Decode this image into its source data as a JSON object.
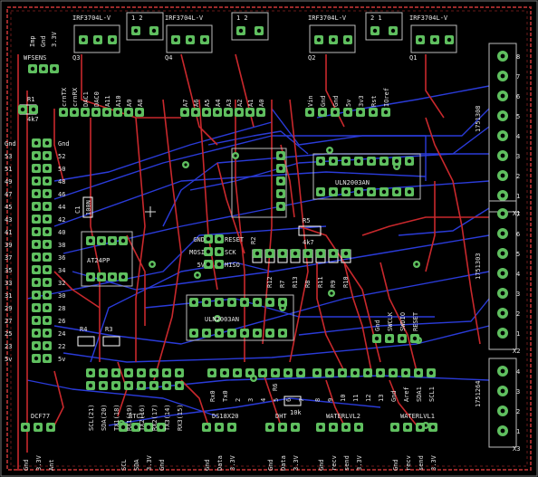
{
  "board": {
    "colors": {
      "background": "#000000",
      "top_copper": "#c8282c",
      "bottom_copper": "#2a3bd8",
      "pad": "#5fbf5f",
      "silk": "#e6e6e6",
      "frame": "#9a2a2a"
    },
    "mosfets": [
      {
        "part": "IRF3704L-V",
        "ref": "Q3",
        "pins": "G D S"
      },
      {
        "part": "IRF3704L-V",
        "ref": "Q4",
        "pins": "G D S"
      },
      {
        "part": "IRF3704L-V",
        "ref": "Q2",
        "pins": "G D S"
      },
      {
        "part": "IRF3704L-V",
        "ref": "Q1",
        "pins": "G D S"
      }
    ],
    "jumpers": [
      "1 2",
      "1 2",
      "2 1",
      "2 1"
    ],
    "sensor_header": {
      "name": "WFSENS",
      "pins": [
        "Imp",
        "Gnd",
        "3.3V"
      ]
    },
    "resistors": [
      "R1",
      "4k7",
      "R2",
      "R5",
      "4k7",
      "R3",
      "R4",
      "R6",
      "10k",
      "R7",
      "R8",
      "R9",
      "R10",
      "R11",
      "R12",
      "R13"
    ],
    "capacitors": [
      "C1",
      "100N"
    ],
    "ics": [
      "AT24PP",
      "ULN2003AN",
      "ULN2003AN"
    ],
    "icsp": [
      "GND",
      "MOSI",
      "5V",
      "RESET",
      "SCK",
      "MISO"
    ],
    "arduino_top_left": [
      "crnTX",
      "crnRX",
      "DAC1",
      "DAC0",
      "A11",
      "A10",
      "A9",
      "A8"
    ],
    "arduino_top_mid": [
      "A7",
      "A6",
      "A5",
      "A4",
      "A3",
      "A2",
      "A1",
      "A0"
    ],
    "arduino_top_right": [
      "Vin",
      "Gnd",
      "Gnd",
      "5v",
      "3v3",
      "Rst",
      "IOref"
    ],
    "left_pins": [
      "Gnd",
      "53",
      "51",
      "49",
      "47",
      "45",
      "43",
      "41",
      "39",
      "37",
      "35",
      "33",
      "31",
      "29",
      "27",
      "25",
      "23",
      "5v"
    ],
    "right_pins": [
      "Gnd",
      "52",
      "50",
      "48",
      "46",
      "44",
      "42",
      "40",
      "38",
      "36",
      "34",
      "32",
      "30",
      "28",
      "26",
      "24",
      "22",
      "5v"
    ],
    "bottom_left": [
      "SCL(21)",
      "SDA(20)",
      "TX1(18)",
      "RX1(19)",
      "TX2(16)",
      "RX2(17)",
      "TX3(14)",
      "RX3(15)"
    ],
    "bottom_mid": [
      "Rx0",
      "Tx0",
      "2",
      "3",
      "4",
      "5",
      "6",
      "7"
    ],
    "bottom_right": [
      "8",
      "9",
      "10",
      "11",
      "12",
      "13",
      "Gnd",
      "Aref",
      "SDA1",
      "SCL1"
    ],
    "swd": [
      "Gnd",
      "SWCLK",
      "SWDIO",
      "RESET"
    ],
    "connectors": [
      {
        "name": "DCF77",
        "pins": [
          "Gnd",
          "3.3V",
          "Ant"
        ]
      },
      {
        "name": "RTC1",
        "pins": [
          "SCL",
          "SDA",
          "3.3V",
          "Gnd"
        ]
      },
      {
        "name": "DS18X20",
        "pins": [
          "Gnd",
          "Data",
          "3.3V"
        ]
      },
      {
        "name": "DHT",
        "pins": [
          "Gnd",
          "Data",
          "3.3V"
        ]
      },
      {
        "name": "WATERLVL2",
        "pins": [
          "Gnd",
          "recv",
          "send",
          "3.3V"
        ]
      },
      {
        "name": "WATERLVL1",
        "pins": [
          "Gnd",
          "recv",
          "send",
          "3.3V"
        ]
      }
    ],
    "terminals": [
      {
        "part": "1751308",
        "ref": "X1",
        "pins": [
          "8",
          "7",
          "6",
          "5",
          "4",
          "3",
          "2",
          "1"
        ]
      },
      {
        "part": "1751303",
        "ref": "X2",
        "pins": [
          "7",
          "6",
          "5",
          "4",
          "3",
          "2",
          "1"
        ]
      },
      {
        "part": "1751264",
        "ref": "X3",
        "pins": [
          "4",
          "3",
          "2",
          "1"
        ]
      }
    ],
    "misc_labels": [
      "Imp",
      "Gnd",
      "3.3V",
      "4",
      "4k7"
    ]
  }
}
